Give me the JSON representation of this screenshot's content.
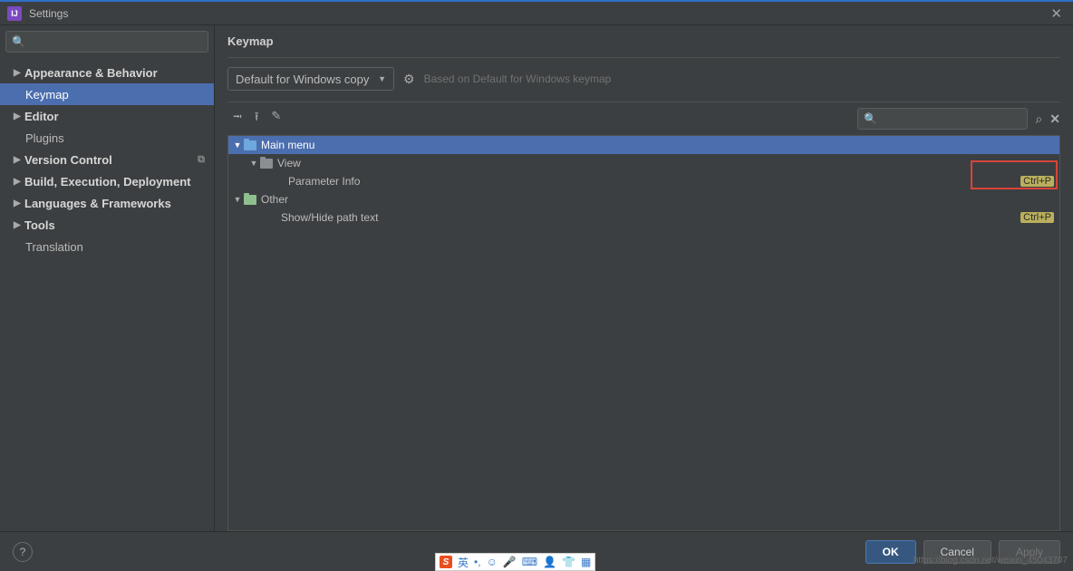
{
  "window": {
    "title": "Settings"
  },
  "sidebar": {
    "search_placeholder": "",
    "items": [
      {
        "label": "Appearance & Behavior",
        "expandable": true,
        "bold": true
      },
      {
        "label": "Keymap",
        "expandable": false,
        "selected": true
      },
      {
        "label": "Editor",
        "expandable": true,
        "bold": true
      },
      {
        "label": "Plugins",
        "expandable": false
      },
      {
        "label": "Version Control",
        "expandable": true,
        "bold": true,
        "badge": "vcs"
      },
      {
        "label": "Build, Execution, Deployment",
        "expandable": true,
        "bold": true
      },
      {
        "label": "Languages & Frameworks",
        "expandable": true,
        "bold": true
      },
      {
        "label": "Tools",
        "expandable": true,
        "bold": true
      },
      {
        "label": "Translation",
        "expandable": false
      }
    ]
  },
  "content": {
    "title": "Keymap",
    "scheme": "Default for Windows copy",
    "based_on": "Based on Default for Windows keymap",
    "search_placeholder": "",
    "tree": {
      "main_menu": "Main menu",
      "view": "View",
      "parameter_info": "Parameter Info",
      "other": "Other",
      "show_hide": "Show/Hide path text",
      "shortcut": "Ctrl+P"
    }
  },
  "buttons": {
    "ok": "OK",
    "cancel": "Cancel",
    "apply": "Apply",
    "help": "?"
  },
  "watermark": "https://blog.csdn.net/weixin_45043707",
  "ime": {
    "lang": "英"
  }
}
